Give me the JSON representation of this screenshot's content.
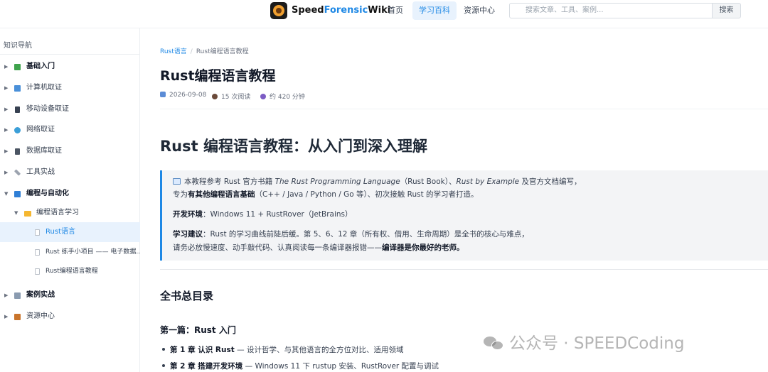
{
  "header": {
    "brand_prefix": "Speed",
    "brand_highlight": "Forensic",
    "brand_suffix": "Wiki",
    "nav": [
      "首页",
      "学习百科",
      "资源中心"
    ],
    "search_placeholder": "搜索文章、工具、案例...",
    "search_button": "搜索"
  },
  "sidebar": {
    "title": "知识导航",
    "items": [
      {
        "label": "基础入门",
        "icon": "books-icon"
      },
      {
        "label": "计算机取证",
        "icon": "computer-icon"
      },
      {
        "label": "移动设备取证",
        "icon": "phone-icon"
      },
      {
        "label": "网络取证",
        "icon": "globe-icon"
      },
      {
        "label": "数据库取证",
        "icon": "database-icon"
      },
      {
        "label": "工具实战",
        "icon": "tools-icon"
      },
      {
        "label": "编程与自动化",
        "icon": "code-icon"
      },
      {
        "label": "编程语言学习",
        "icon": "folder-icon"
      },
      {
        "label": "Rust语言",
        "icon": "doc-icon"
      },
      {
        "label": "Rust 练手小项目 —— 电子数据...",
        "icon": "doc-icon"
      },
      {
        "label": "Rust编程语言教程",
        "icon": "doc-icon"
      },
      {
        "label": "案例实战",
        "icon": "case-icon"
      },
      {
        "label": "资源中心",
        "icon": "resource-icon"
      }
    ]
  },
  "main": {
    "breadcrumb": [
      "Rust语言",
      "Rust编程语言教程"
    ],
    "title": "Rust编程语言教程",
    "meta": {
      "date": "2026-09-08",
      "reads": "15 次阅读",
      "duration": "约 420 分钟"
    },
    "h1": "Rust 编程语言教程：从入门到深入理解",
    "quote": {
      "line1_a": "本教程参考 Rust 官方书籍 ",
      "line1_i1": "The Rust Programming Language",
      "line1_b": "（Rust Book）、",
      "line1_i2": "Rust by Example",
      "line1_c": " 及官方文档编写，",
      "line2_a": "专为",
      "line2_b": "有其他编程语言基础",
      "line2_c": "（C++ / Java / Python / Go 等）、初次接触 Rust 的学习者打造。",
      "env_label": "开发环境",
      "env_value": "：Windows 11 + RustRover（JetBrains）",
      "advice_label": "学习建议",
      "advice_value": "：Rust 的学习曲线前陡后缓。第 5、6、12 章（所有权、借用、生命周期）是全书的核心与难点，",
      "advice_line2_a": "请务必放慢速度、动手敲代码、认真阅读每一条编译器报错——",
      "advice_line2_b": "编译器是你最好的老师。"
    },
    "h2": "全书总目录",
    "h3": "第一篇：Rust 入门",
    "list": [
      {
        "bold": "第 1 章 认识 Rust",
        "rest": " — 设计哲学、与其他语言的全方位对比、适用领域"
      },
      {
        "bold": "第 2 章 搭建开发环境",
        "rest": " — Windows 11 下 rustup 安装、RustRover 配置与调试"
      }
    ]
  },
  "watermark": "公众号 · SPEEDCoding",
  "colors": {
    "accent": "#1e88e5",
    "active_bg": "#e8f2fd"
  }
}
